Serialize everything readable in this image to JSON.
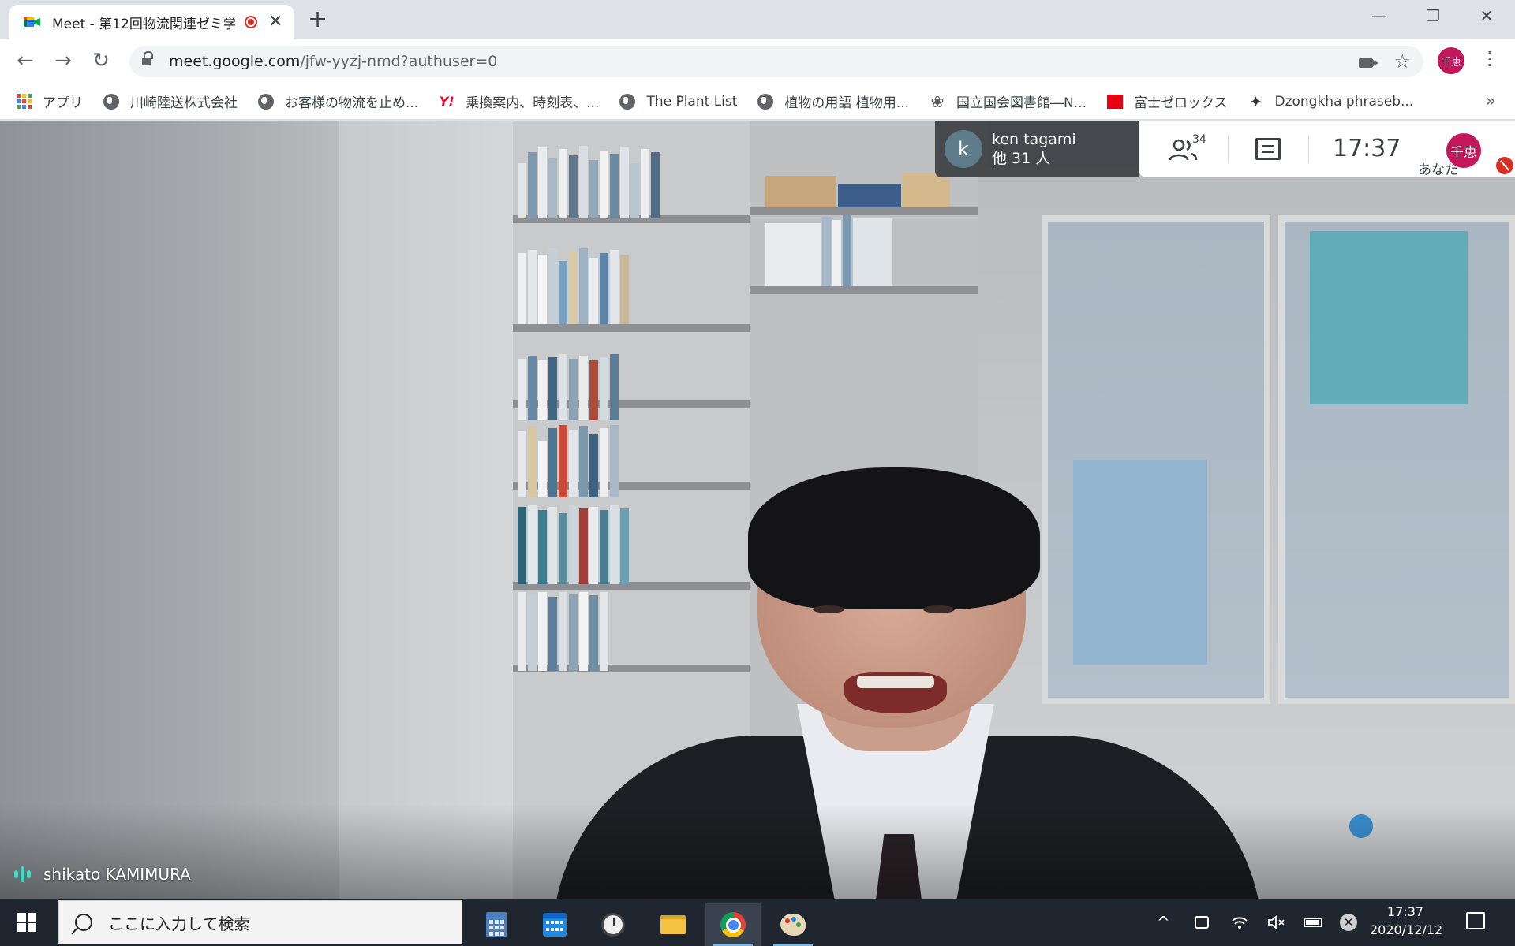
{
  "browser": {
    "tab": {
      "title": "Meet - 第12回物流関連ゼミ学",
      "close": "✕"
    },
    "new_tab": "+",
    "window": {
      "minimize": "—",
      "restore": "❐",
      "close": "✕"
    },
    "nav": {
      "back": "←",
      "forward": "→",
      "reload": "↻"
    },
    "url": {
      "host": "meet.google.com",
      "path": "/jfw-yyzj-nmd?authuser=0"
    },
    "profile_initials": "千恵",
    "menu": "⋮",
    "star": "☆"
  },
  "bookmarks": {
    "items": [
      {
        "label": "アプリ",
        "icon": "apps-grid-icon"
      },
      {
        "label": "川崎陸送株式会社",
        "icon": "globe-icon"
      },
      {
        "label": "お客様の物流を止め...",
        "icon": "globe-icon"
      },
      {
        "label": "乗換案内、時刻表、...",
        "icon": "yahoo-icon",
        "icon_glyph": "Y!"
      },
      {
        "label": "The Plant List",
        "icon": "globe-icon"
      },
      {
        "label": "植物の用語 植物用...",
        "icon": "globe-icon"
      },
      {
        "label": "国立国会図書館―N...",
        "icon": "ndl-icon",
        "icon_glyph": "❀"
      },
      {
        "label": "富士ゼロックス",
        "icon": "fujixerox-icon"
      },
      {
        "label": "Dzongkha phraseb...",
        "icon": "sparkle-icon",
        "icon_glyph": "✦"
      }
    ],
    "more": "»"
  },
  "meet": {
    "presenter_pill": {
      "avatar_letter": "k",
      "name": "ken tagami",
      "others": "他 31 人"
    },
    "participant_count": "34",
    "clock": "17:37",
    "self": {
      "initials": "千恵",
      "label": "あなた"
    },
    "speaker_name": "shikato KAMIMURA",
    "colors": {
      "accent_teal": "#4ed6c3",
      "avatar_pink": "#c2185b",
      "mute_red": "#d93025"
    }
  },
  "taskbar": {
    "search_placeholder": "ここに入力して検索",
    "apps": [
      {
        "name": "calculator-icon"
      },
      {
        "name": "calendar-icon"
      },
      {
        "name": "alarms-clock-icon"
      },
      {
        "name": "file-explorer-icon"
      },
      {
        "name": "chrome-icon",
        "active": true
      },
      {
        "name": "paint-icon"
      }
    ],
    "tray": {
      "chevron": "^",
      "time": "17:37",
      "date": "2020/12/12",
      "x_badge": "✕"
    }
  }
}
